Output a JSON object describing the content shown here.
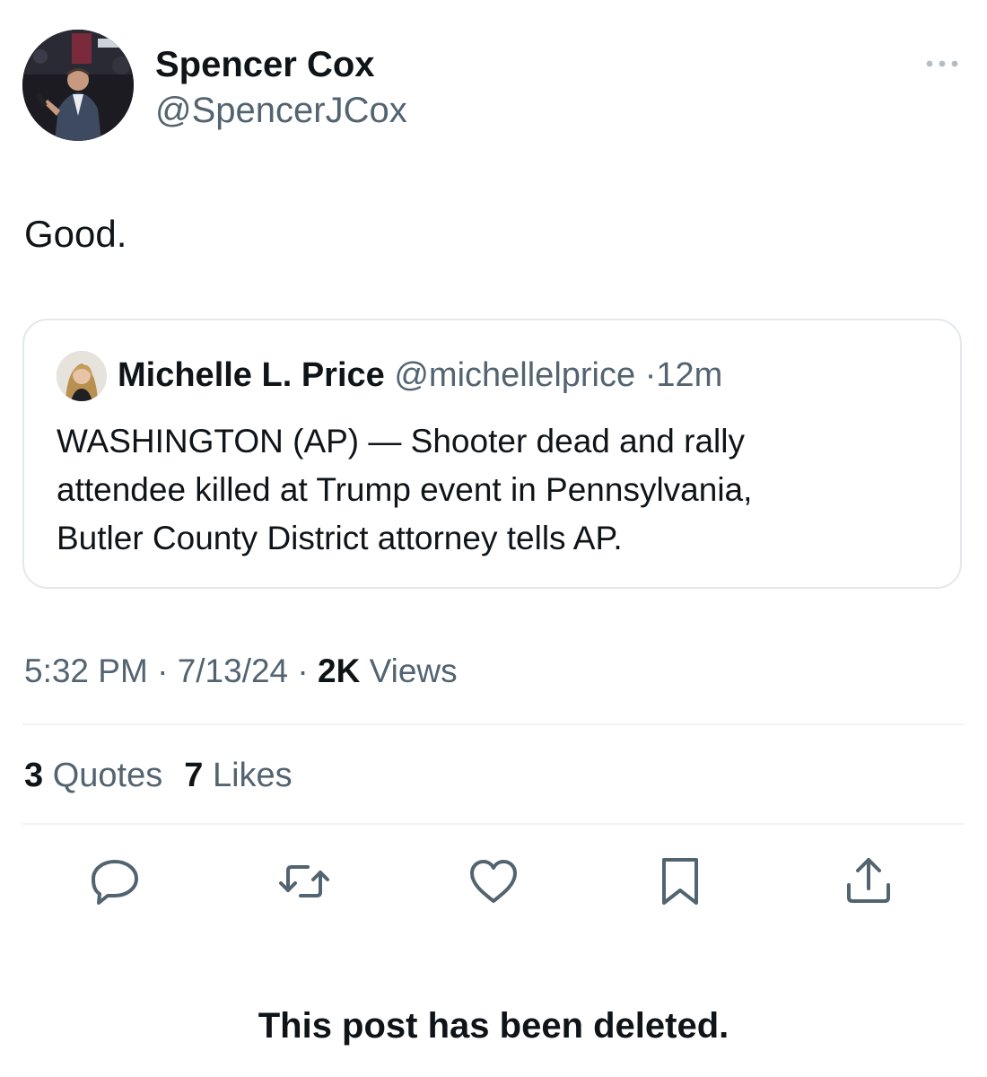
{
  "author": {
    "display_name": "Spencer Cox",
    "handle": "@SpencerJCox"
  },
  "post": {
    "text": "Good."
  },
  "quoted_post": {
    "author_name": "Michelle L. Price",
    "author_handle": "@michellelprice",
    "separator": "·",
    "age": "12m",
    "text_lines": [
      "WASHINGTON (AP) — Shooter dead and rally",
      "attendee killed at Trump event in Pennsylvania,",
      "Butler County District attorney tells AP."
    ]
  },
  "meta": {
    "time": "5:32 PM",
    "separator": "·",
    "date": "7/13/24",
    "views_count": "2K",
    "views_label": "Views"
  },
  "stats": {
    "quotes_count": "3",
    "quotes_label": "Quotes",
    "likes_count": "7",
    "likes_label": "Likes"
  },
  "actions": {
    "icons": [
      "reply-icon",
      "repost-icon",
      "like-icon",
      "bookmark-icon",
      "share-icon"
    ]
  },
  "notice": {
    "text": "This post has been deleted."
  },
  "colors": {
    "primary_text": "#0f1419",
    "secondary_text": "#536471",
    "border": "#e4e8eb",
    "divider": "#eff3f4"
  }
}
